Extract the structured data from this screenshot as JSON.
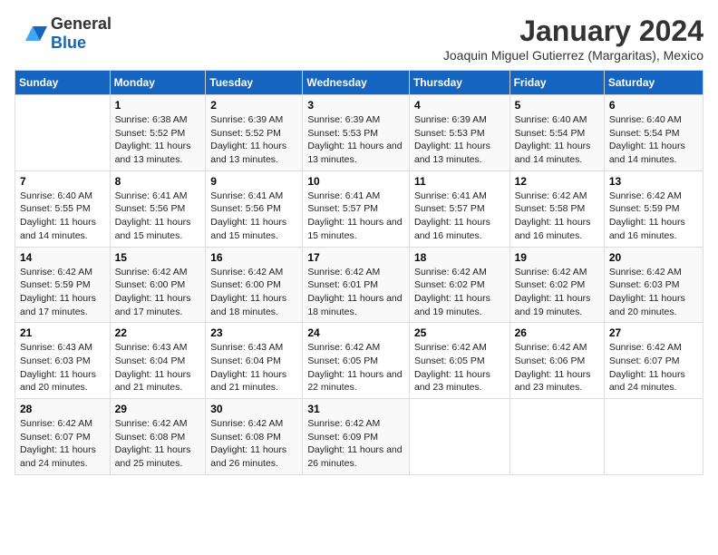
{
  "logo": {
    "general": "General",
    "blue": "Blue"
  },
  "title": "January 2024",
  "subtitle": "Joaquin Miguel Gutierrez (Margaritas), Mexico",
  "days_of_week": [
    "Sunday",
    "Monday",
    "Tuesday",
    "Wednesday",
    "Thursday",
    "Friday",
    "Saturday"
  ],
  "weeks": [
    [
      {
        "num": "",
        "sunrise": "",
        "sunset": "",
        "daylight": ""
      },
      {
        "num": "1",
        "sunrise": "Sunrise: 6:38 AM",
        "sunset": "Sunset: 5:52 PM",
        "daylight": "Daylight: 11 hours and 13 minutes."
      },
      {
        "num": "2",
        "sunrise": "Sunrise: 6:39 AM",
        "sunset": "Sunset: 5:52 PM",
        "daylight": "Daylight: 11 hours and 13 minutes."
      },
      {
        "num": "3",
        "sunrise": "Sunrise: 6:39 AM",
        "sunset": "Sunset: 5:53 PM",
        "daylight": "Daylight: 11 hours and 13 minutes."
      },
      {
        "num": "4",
        "sunrise": "Sunrise: 6:39 AM",
        "sunset": "Sunset: 5:53 PM",
        "daylight": "Daylight: 11 hours and 13 minutes."
      },
      {
        "num": "5",
        "sunrise": "Sunrise: 6:40 AM",
        "sunset": "Sunset: 5:54 PM",
        "daylight": "Daylight: 11 hours and 14 minutes."
      },
      {
        "num": "6",
        "sunrise": "Sunrise: 6:40 AM",
        "sunset": "Sunset: 5:54 PM",
        "daylight": "Daylight: 11 hours and 14 minutes."
      }
    ],
    [
      {
        "num": "7",
        "sunrise": "Sunrise: 6:40 AM",
        "sunset": "Sunset: 5:55 PM",
        "daylight": "Daylight: 11 hours and 14 minutes."
      },
      {
        "num": "8",
        "sunrise": "Sunrise: 6:41 AM",
        "sunset": "Sunset: 5:56 PM",
        "daylight": "Daylight: 11 hours and 15 minutes."
      },
      {
        "num": "9",
        "sunrise": "Sunrise: 6:41 AM",
        "sunset": "Sunset: 5:56 PM",
        "daylight": "Daylight: 11 hours and 15 minutes."
      },
      {
        "num": "10",
        "sunrise": "Sunrise: 6:41 AM",
        "sunset": "Sunset: 5:57 PM",
        "daylight": "Daylight: 11 hours and 15 minutes."
      },
      {
        "num": "11",
        "sunrise": "Sunrise: 6:41 AM",
        "sunset": "Sunset: 5:57 PM",
        "daylight": "Daylight: 11 hours and 16 minutes."
      },
      {
        "num": "12",
        "sunrise": "Sunrise: 6:42 AM",
        "sunset": "Sunset: 5:58 PM",
        "daylight": "Daylight: 11 hours and 16 minutes."
      },
      {
        "num": "13",
        "sunrise": "Sunrise: 6:42 AM",
        "sunset": "Sunset: 5:59 PM",
        "daylight": "Daylight: 11 hours and 16 minutes."
      }
    ],
    [
      {
        "num": "14",
        "sunrise": "Sunrise: 6:42 AM",
        "sunset": "Sunset: 5:59 PM",
        "daylight": "Daylight: 11 hours and 17 minutes."
      },
      {
        "num": "15",
        "sunrise": "Sunrise: 6:42 AM",
        "sunset": "Sunset: 6:00 PM",
        "daylight": "Daylight: 11 hours and 17 minutes."
      },
      {
        "num": "16",
        "sunrise": "Sunrise: 6:42 AM",
        "sunset": "Sunset: 6:00 PM",
        "daylight": "Daylight: 11 hours and 18 minutes."
      },
      {
        "num": "17",
        "sunrise": "Sunrise: 6:42 AM",
        "sunset": "Sunset: 6:01 PM",
        "daylight": "Daylight: 11 hours and 18 minutes."
      },
      {
        "num": "18",
        "sunrise": "Sunrise: 6:42 AM",
        "sunset": "Sunset: 6:02 PM",
        "daylight": "Daylight: 11 hours and 19 minutes."
      },
      {
        "num": "19",
        "sunrise": "Sunrise: 6:42 AM",
        "sunset": "Sunset: 6:02 PM",
        "daylight": "Daylight: 11 hours and 19 minutes."
      },
      {
        "num": "20",
        "sunrise": "Sunrise: 6:42 AM",
        "sunset": "Sunset: 6:03 PM",
        "daylight": "Daylight: 11 hours and 20 minutes."
      }
    ],
    [
      {
        "num": "21",
        "sunrise": "Sunrise: 6:43 AM",
        "sunset": "Sunset: 6:03 PM",
        "daylight": "Daylight: 11 hours and 20 minutes."
      },
      {
        "num": "22",
        "sunrise": "Sunrise: 6:43 AM",
        "sunset": "Sunset: 6:04 PM",
        "daylight": "Daylight: 11 hours and 21 minutes."
      },
      {
        "num": "23",
        "sunrise": "Sunrise: 6:43 AM",
        "sunset": "Sunset: 6:04 PM",
        "daylight": "Daylight: 11 hours and 21 minutes."
      },
      {
        "num": "24",
        "sunrise": "Sunrise: 6:42 AM",
        "sunset": "Sunset: 6:05 PM",
        "daylight": "Daylight: 11 hours and 22 minutes."
      },
      {
        "num": "25",
        "sunrise": "Sunrise: 6:42 AM",
        "sunset": "Sunset: 6:05 PM",
        "daylight": "Daylight: 11 hours and 23 minutes."
      },
      {
        "num": "26",
        "sunrise": "Sunrise: 6:42 AM",
        "sunset": "Sunset: 6:06 PM",
        "daylight": "Daylight: 11 hours and 23 minutes."
      },
      {
        "num": "27",
        "sunrise": "Sunrise: 6:42 AM",
        "sunset": "Sunset: 6:07 PM",
        "daylight": "Daylight: 11 hours and 24 minutes."
      }
    ],
    [
      {
        "num": "28",
        "sunrise": "Sunrise: 6:42 AM",
        "sunset": "Sunset: 6:07 PM",
        "daylight": "Daylight: 11 hours and 24 minutes."
      },
      {
        "num": "29",
        "sunrise": "Sunrise: 6:42 AM",
        "sunset": "Sunset: 6:08 PM",
        "daylight": "Daylight: 11 hours and 25 minutes."
      },
      {
        "num": "30",
        "sunrise": "Sunrise: 6:42 AM",
        "sunset": "Sunset: 6:08 PM",
        "daylight": "Daylight: 11 hours and 26 minutes."
      },
      {
        "num": "31",
        "sunrise": "Sunrise: 6:42 AM",
        "sunset": "Sunset: 6:09 PM",
        "daylight": "Daylight: 11 hours and 26 minutes."
      },
      {
        "num": "",
        "sunrise": "",
        "sunset": "",
        "daylight": ""
      },
      {
        "num": "",
        "sunrise": "",
        "sunset": "",
        "daylight": ""
      },
      {
        "num": "",
        "sunrise": "",
        "sunset": "",
        "daylight": ""
      }
    ]
  ]
}
